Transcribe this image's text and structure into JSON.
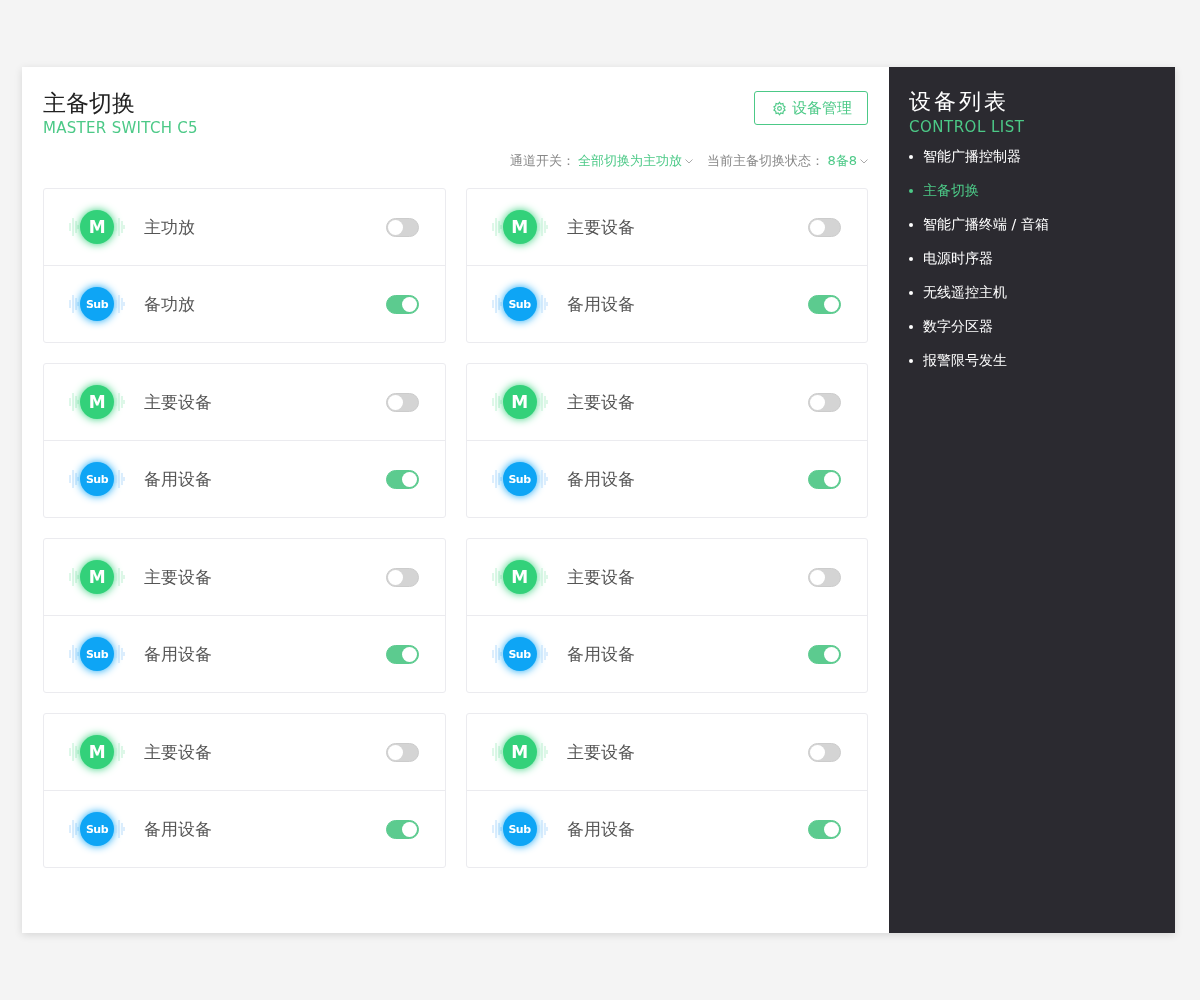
{
  "header": {
    "title": "主备切换",
    "subtitle": "MASTER SWITCH C5",
    "manage_button": "设备管理"
  },
  "filters": [
    {
      "label": "通道开关：",
      "value": "全部切换为主功放"
    },
    {
      "label": "当前主备切换状态：",
      "value": "8备8"
    }
  ],
  "cards": [
    {
      "rows": [
        {
          "kind": "main",
          "badge": "M",
          "label": "主功放",
          "on": false
        },
        {
          "kind": "sub",
          "badge": "Sub",
          "label": "备功放",
          "on": true
        }
      ]
    },
    {
      "rows": [
        {
          "kind": "main",
          "badge": "M",
          "label": "主要设备",
          "on": false
        },
        {
          "kind": "sub",
          "badge": "Sub",
          "label": "备用设备",
          "on": true
        }
      ]
    },
    {
      "rows": [
        {
          "kind": "main",
          "badge": "M",
          "label": "主要设备",
          "on": false
        },
        {
          "kind": "sub",
          "badge": "Sub",
          "label": "备用设备",
          "on": true
        }
      ]
    },
    {
      "rows": [
        {
          "kind": "main",
          "badge": "M",
          "label": "主要设备",
          "on": false
        },
        {
          "kind": "sub",
          "badge": "Sub",
          "label": "备用设备",
          "on": true
        }
      ]
    },
    {
      "rows": [
        {
          "kind": "main",
          "badge": "M",
          "label": "主要设备",
          "on": false
        },
        {
          "kind": "sub",
          "badge": "Sub",
          "label": "备用设备",
          "on": true
        }
      ]
    },
    {
      "rows": [
        {
          "kind": "main",
          "badge": "M",
          "label": "主要设备",
          "on": false
        },
        {
          "kind": "sub",
          "badge": "Sub",
          "label": "备用设备",
          "on": true
        }
      ]
    },
    {
      "rows": [
        {
          "kind": "main",
          "badge": "M",
          "label": "主要设备",
          "on": false
        },
        {
          "kind": "sub",
          "badge": "Sub",
          "label": "备用设备",
          "on": true
        }
      ]
    },
    {
      "rows": [
        {
          "kind": "main",
          "badge": "M",
          "label": "主要设备",
          "on": false
        },
        {
          "kind": "sub",
          "badge": "Sub",
          "label": "备用设备",
          "on": true
        }
      ]
    }
  ],
  "sidebar": {
    "title": "设备列表",
    "subtitle": "CONTROL LIST",
    "items": [
      {
        "label": "智能广播控制器",
        "selected": false
      },
      {
        "label": "主备切换",
        "selected": true
      },
      {
        "label": "智能广播终端 / 音箱",
        "selected": false
      },
      {
        "label": "电源时序器",
        "selected": false
      },
      {
        "label": "无线遥控主机",
        "selected": false
      },
      {
        "label": "数字分区器",
        "selected": false
      },
      {
        "label": "报警限号发生",
        "selected": false
      }
    ]
  }
}
